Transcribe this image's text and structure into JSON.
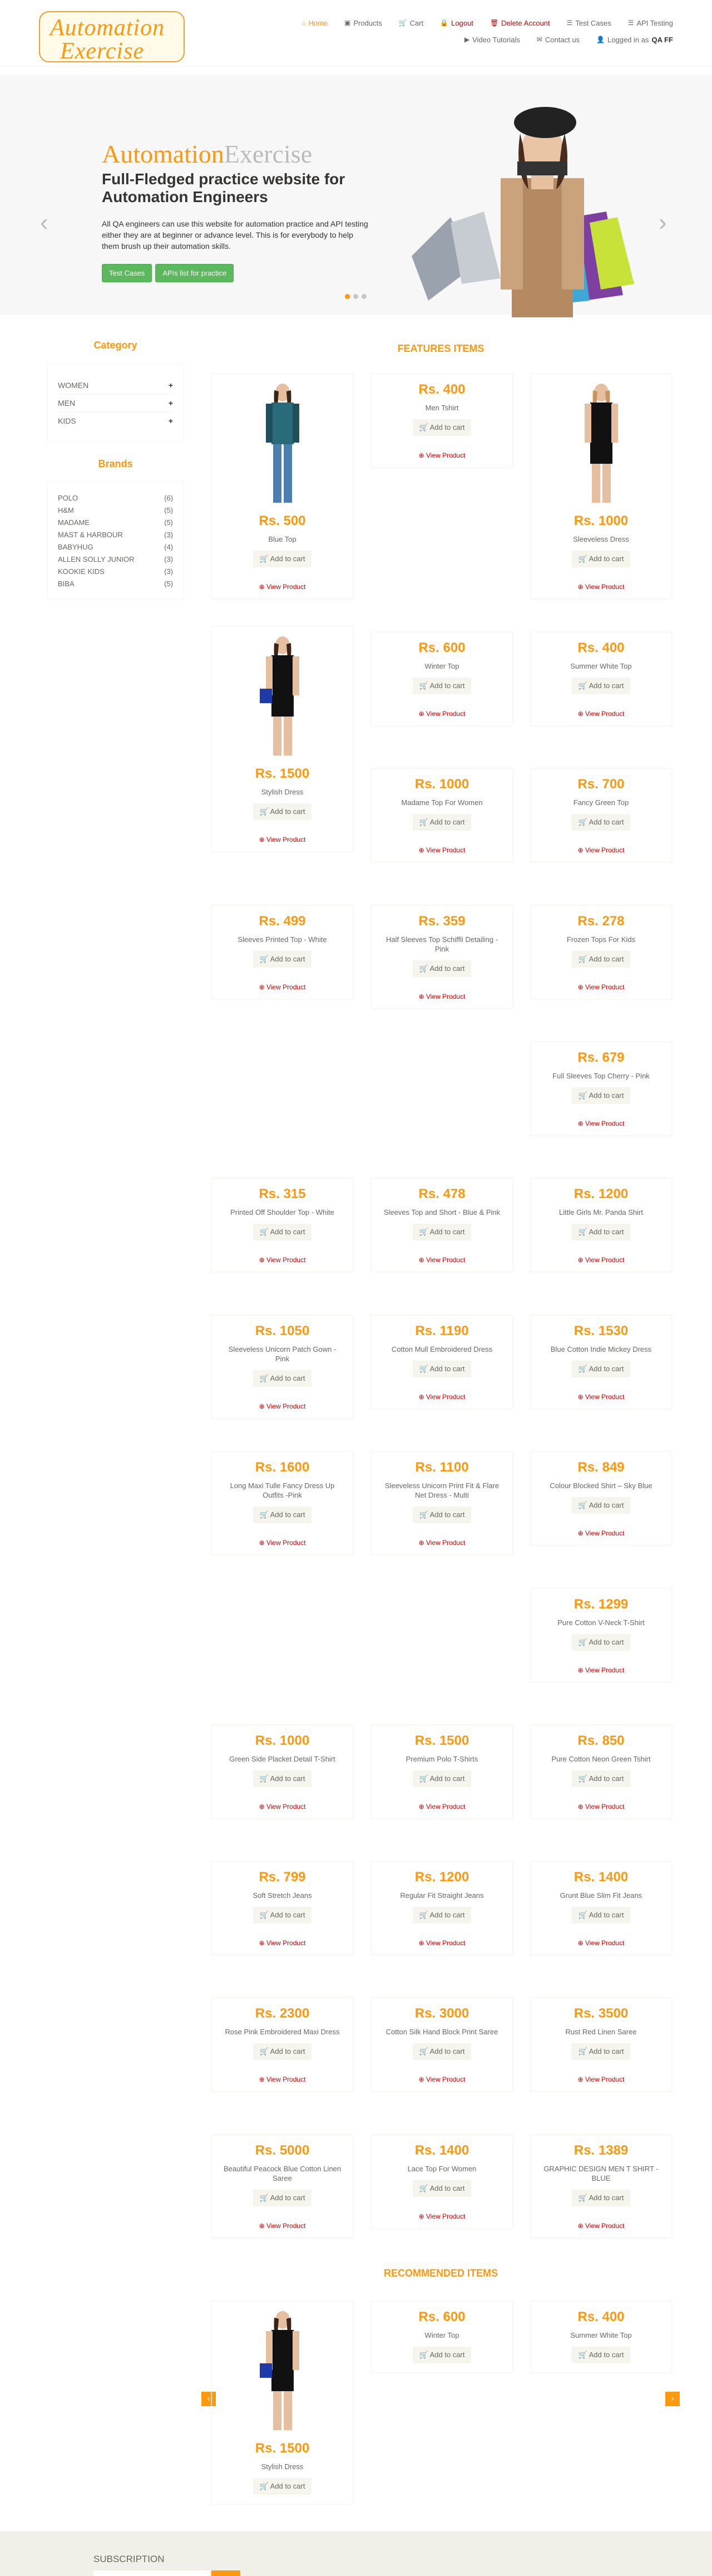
{
  "header": {
    "logo": {
      "line1": "Automation",
      "line2": "Exercise"
    },
    "nav": [
      {
        "label": "Home",
        "icon": "home-icon",
        "glyph": "⌂"
      },
      {
        "label": "Products",
        "icon": "products-icon",
        "glyph": "▣"
      },
      {
        "label": "Cart",
        "icon": "cart-icon",
        "glyph": "🛒"
      },
      {
        "label": "Logout",
        "icon": "lock-icon",
        "glyph": "🔒"
      },
      {
        "label": "Delete Account",
        "icon": "trash-icon",
        "glyph": "🗑"
      },
      {
        "label": "Test Cases",
        "icon": "list-icon",
        "glyph": "☰"
      },
      {
        "label": "API Testing",
        "icon": "list-icon",
        "glyph": "☰"
      },
      {
        "label": "Video Tutorials",
        "icon": "youtube-icon",
        "glyph": "▶"
      },
      {
        "label": "Contact us",
        "icon": "envelope-icon",
        "glyph": "✉"
      }
    ],
    "logged_in_prefix": "Logged in as",
    "logged_in_user": "QA FF"
  },
  "slider": {
    "title_a": "Automation",
    "title_b": "Exercise",
    "subtitle": "Full-Fledged practice website for Automation Engineers",
    "description": "All QA engineers can use this website for automation practice and API testing either they are at beginner or advance level. This is for everybody to help them brush up their automation skills.",
    "btn_test_cases": "Test Cases",
    "btn_apis": "APIs list for practice"
  },
  "sidebar": {
    "category_title": "Category",
    "categories": [
      "Women",
      "Men",
      "Kids"
    ],
    "brands_title": "Brands",
    "brands": [
      {
        "name": "Polo",
        "count": "(6)"
      },
      {
        "name": "H&M",
        "count": "(5)"
      },
      {
        "name": "Madame",
        "count": "(5)"
      },
      {
        "name": "Mast & Harbour",
        "count": "(3)"
      },
      {
        "name": "Babyhug",
        "count": "(4)"
      },
      {
        "name": "Allen Solly Junior",
        "count": "(3)"
      },
      {
        "name": "Kookie Kids",
        "count": "(3)"
      },
      {
        "name": "Biba",
        "count": "(5)"
      }
    ]
  },
  "features_title": "Features Items",
  "cart_label": "Add to cart",
  "view_label": "View Product",
  "products": [
    {
      "price": "Rs. 500",
      "name": "Blue Top"
    },
    {
      "price": "Rs. 400",
      "name": "Men Tshirt"
    },
    {
      "price": "Rs. 1000",
      "name": "Sleeveless Dress"
    },
    {
      "price": "Rs. 1500",
      "name": "Stylish Dress"
    },
    {
      "price": "Rs. 600",
      "name": "Winter Top"
    },
    {
      "price": "Rs. 400",
      "name": "Summer White Top"
    },
    {
      "price": "Rs. 1000",
      "name": "Madame Top For Women"
    },
    {
      "price": "Rs. 700",
      "name": "Fancy Green Top"
    },
    {
      "price": "Rs. 499",
      "name": "Sleeves Printed Top - White"
    },
    {
      "price": "Rs. 359",
      "name": "Half Sleeves Top Schiffli Detailing - Pink"
    },
    {
      "price": "Rs. 278",
      "name": "Frozen Tops For Kids"
    },
    {
      "price": "Rs. 679",
      "name": "Full Sleeves Top Cherry - Pink"
    },
    {
      "price": "Rs. 315",
      "name": "Printed Off Shoulder Top - White"
    },
    {
      "price": "Rs. 478",
      "name": "Sleeves Top and Short - Blue & Pink"
    },
    {
      "price": "Rs. 1200",
      "name": "Little Girls Mr. Panda Shirt"
    },
    {
      "price": "Rs. 1050",
      "name": "Sleeveless Unicorn Patch Gown - Pink"
    },
    {
      "price": "Rs. 1190",
      "name": "Cotton Mull Embroidered Dress"
    },
    {
      "price": "Rs. 1530",
      "name": "Blue Cotton Indie Mickey Dress"
    },
    {
      "price": "Rs. 1600",
      "name": "Long Maxi Tulle Fancy Dress Up Outfits -Pink"
    },
    {
      "price": "Rs. 1100",
      "name": "Sleeveless Unicorn Print Fit & Flare Net Dress - Multi"
    },
    {
      "price": "Rs. 849",
      "name": "Colour Blocked Shirt – Sky Blue"
    },
    {
      "price": "Rs. 1299",
      "name": "Pure Cotton V-Neck T-Shirt"
    },
    {
      "price": "Rs. 1000",
      "name": "Green Side Placket Detail T-Shirt"
    },
    {
      "price": "Rs. 1500",
      "name": "Premium Polo T-Shirts"
    },
    {
      "price": "Rs. 850",
      "name": "Pure Cotton Neon Green Tshirt"
    },
    {
      "price": "Rs. 799",
      "name": "Soft Stretch Jeans"
    },
    {
      "price": "Rs. 1200",
      "name": "Regular Fit Straight Jeans"
    },
    {
      "price": "Rs. 1400",
      "name": "Grunt Blue Slim Fit Jeans"
    },
    {
      "price": "Rs. 2300",
      "name": "Rose Pink Embroidered Maxi Dress"
    },
    {
      "price": "Rs. 3000",
      "name": "Cotton Silk Hand Block Print Saree"
    },
    {
      "price": "Rs. 3500",
      "name": "Rust Red Linen Saree"
    },
    {
      "price": "Rs. 5000",
      "name": "Beautiful Peacock Blue Cotton Linen Saree"
    },
    {
      "price": "Rs. 1400",
      "name": "Lace Top For Women"
    },
    {
      "price": "Rs. 1389",
      "name": "GRAPHIC DESIGN MEN T SHIRT - BLUE"
    }
  ],
  "recommended_title": "Recommended Items",
  "recommended": [
    {
      "price": "Rs. 1500",
      "name": "Stylish Dress"
    },
    {
      "price": "Rs. 600",
      "name": "Winter Top"
    },
    {
      "price": "Rs. 400",
      "name": "Summer White Top"
    }
  ],
  "footer": {
    "subscription_title": "Subscription"
  },
  "colors": {
    "accent": "#FE980F",
    "link_red": "#CC0000",
    "button_green": "#5CB85C"
  }
}
